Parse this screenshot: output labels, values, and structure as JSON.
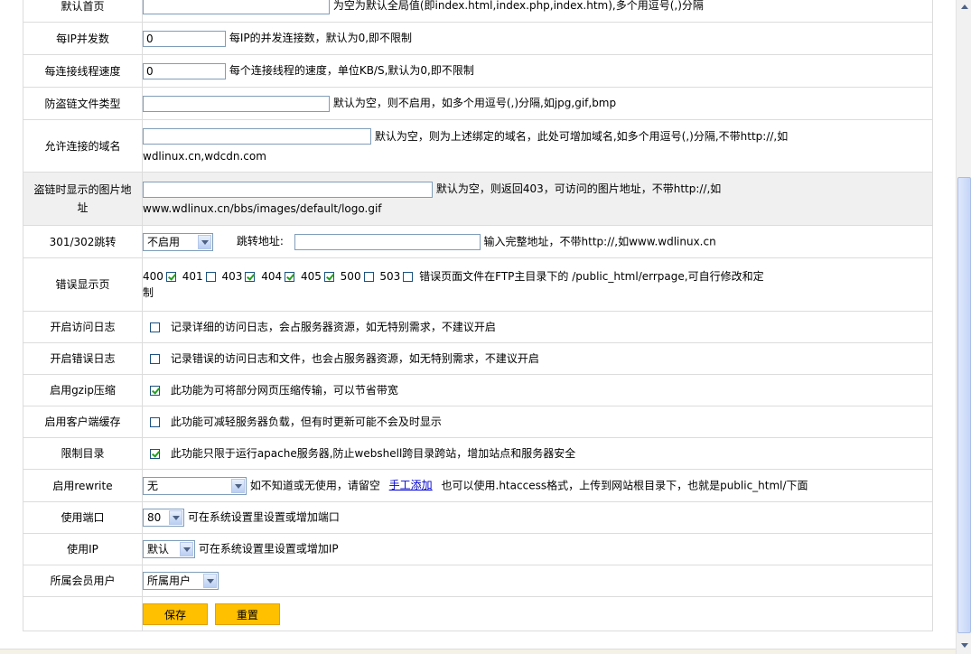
{
  "rows": {
    "default_page": {
      "label": "默认首页",
      "value": "",
      "desc": "为空为默认全局值(即index.html,index.php,index.htm),多个用逗号(,)分隔"
    },
    "per_ip": {
      "label": "每IP并发数",
      "value": "0",
      "desc": "每IP的并发连接数，默认为0,即不限制"
    },
    "speed": {
      "label": "每连接线程速度",
      "value": "0",
      "desc": "每个连接线程的速度，单位KB/S,默认为0,即不限制"
    },
    "hotlink_types": {
      "label": "防盗链文件类型",
      "value": "",
      "desc": "默认为空，则不启用，如多个用逗号(,)分隔,如jpg,gif,bmp"
    },
    "allowed_domains": {
      "label": "允许连接的域名",
      "value": "",
      "desc": "默认为空，则为上述绑定的域名，此处可增加域名,如多个用逗号(,)分隔,不带http://,如",
      "desc2": "wdlinux.cn,wdcdn.com"
    },
    "hotlink_image": {
      "label": "盗链时显示的图片地址",
      "value": "",
      "desc": "默认为空，则返回403，可访问的图片地址，不带http://,如",
      "desc2": "www.wdlinux.cn/bbs/images/default/logo.gif"
    },
    "redirect": {
      "label": "301/302跳转",
      "selected": "不启用",
      "addr_label": "跳转地址:",
      "value": "",
      "desc": "输入完整地址，不带http://,如www.wdlinux.cn"
    },
    "error_page": {
      "label": "错误显示页",
      "codes": [
        {
          "code": "400",
          "checked": true
        },
        {
          "code": "401",
          "checked": false
        },
        {
          "code": "403",
          "checked": true
        },
        {
          "code": "404",
          "checked": true
        },
        {
          "code": "405",
          "checked": true
        },
        {
          "code": "500",
          "checked": false
        },
        {
          "code": "503",
          "checked": false
        }
      ],
      "desc": "错误页面文件在FTP主目录下的 /public_html/errpage,可自行修改和定",
      "desc2": "制"
    },
    "access_log": {
      "label": "开启访问日志",
      "checked": false,
      "desc": "记录详细的访问日志，会占服务器资源，如无特别需求，不建议开启"
    },
    "error_log": {
      "label": "开启错误日志",
      "checked": false,
      "desc": "记录错误的访问日志和文件，也会占服务器资源，如无特别需求，不建议开启"
    },
    "gzip": {
      "label": "启用gzip压缩",
      "checked": true,
      "desc": "此功能为可将部分网页压缩传输，可以节省带宽"
    },
    "client_cache": {
      "label": "启用客户端缓存",
      "checked": false,
      "desc": "此功能可减轻服务器负载，但有时更新可能不会及时显示"
    },
    "restrict_dir": {
      "label": "限制目录",
      "checked": true,
      "desc": "此功能只限于运行apache服务器,防止webshell跨目录跨站，增加站点和服务器安全"
    },
    "rewrite": {
      "label": "启用rewrite",
      "selected": "无",
      "desc": "如不知道或无使用，请留空",
      "link": "手工添加",
      "desc2": "也可以使用.htaccess格式，上传到网站根目录下，也就是public_html/下面"
    },
    "port": {
      "label": "使用端口",
      "selected": "80",
      "desc": "可在系统设置里设置或增加端口"
    },
    "ip": {
      "label": "使用IP",
      "selected": "默认",
      "desc": "可在系统设置里设置或增加IP"
    },
    "member": {
      "label": "所属会员用户",
      "selected": "所属用户"
    }
  },
  "buttons": {
    "save": "保存",
    "reset": "重置"
  },
  "colors": {
    "button_bg": "#ffc000",
    "link": "#0000cc",
    "checkmark": "#21a121",
    "alt_row": "#f0f0f0"
  }
}
